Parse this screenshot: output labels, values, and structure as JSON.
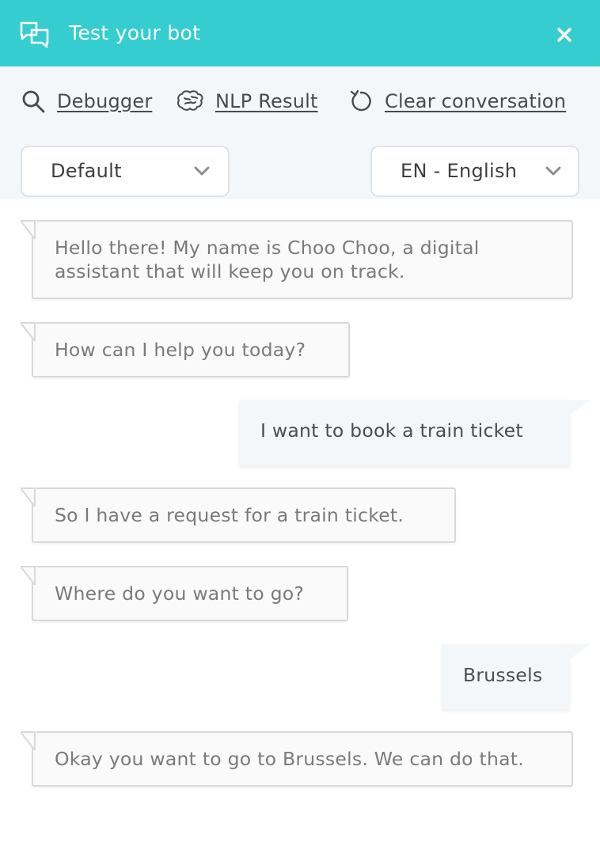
{
  "header": {
    "title": "Test your bot",
    "icon": "chat-bubbles-icon",
    "close_icon": "close-icon",
    "color": "#35cdd0"
  },
  "toolbar": {
    "debugger": {
      "label": "Debugger",
      "icon": "search-icon"
    },
    "nlp": {
      "label": "NLP Result",
      "icon": "brain-icon"
    },
    "clear": {
      "label": "Clear conversation",
      "icon": "refresh-icon"
    }
  },
  "selects": {
    "flow": {
      "value": "Default"
    },
    "language": {
      "value": "EN - English"
    }
  },
  "messages": [
    {
      "from": "bot",
      "text": "Hello there! My name is Choo Choo, a digital assistant that will keep you on track."
    },
    {
      "from": "bot",
      "text": "How can I help you today?"
    },
    {
      "from": "user",
      "text": "I want to book a train ticket"
    },
    {
      "from": "bot",
      "text": "So I have a request for a train ticket."
    },
    {
      "from": "bot",
      "text": "Where do you want to go?"
    },
    {
      "from": "user",
      "text": "Brussels"
    },
    {
      "from": "bot",
      "text": "Okay you want to go to Brussels. We can do that."
    }
  ]
}
